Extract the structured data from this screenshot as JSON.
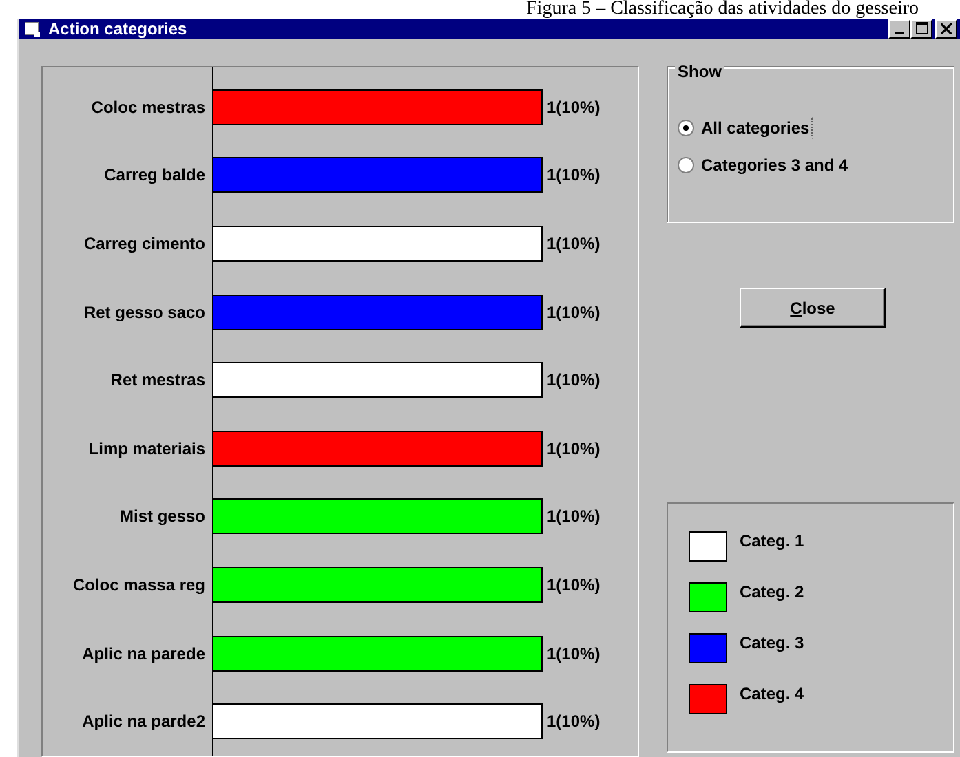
{
  "caption": "Figura 5 – Classificação das atividades do gesseiro",
  "window": {
    "title": "Action categories"
  },
  "rows": [
    {
      "label": "Coloc mestras",
      "color": "#ff0000",
      "reading": "1(10%)"
    },
    {
      "label": "Carreg balde",
      "color": "#0000ff",
      "reading": "1(10%)"
    },
    {
      "label": "Carreg cimento",
      "color": "#ffffff",
      "reading": "1(10%)"
    },
    {
      "label": "Ret gesso saco",
      "color": "#0000ff",
      "reading": "1(10%)"
    },
    {
      "label": "Ret mestras",
      "color": "#ffffff",
      "reading": "1(10%)"
    },
    {
      "label": "Limp materiais",
      "color": "#ff0000",
      "reading": "1(10%)"
    },
    {
      "label": "Mist gesso",
      "color": "#00ff00",
      "reading": "1(10%)"
    },
    {
      "label": "Coloc massa reg",
      "color": "#00ff00",
      "reading": "1(10%)"
    },
    {
      "label": "Aplic na parede",
      "color": "#00ff00",
      "reading": "1(10%)"
    },
    {
      "label": "Aplic na parde2",
      "color": "#ffffff",
      "reading": "1(10%)"
    }
  ],
  "show": {
    "title": "Show",
    "options": [
      {
        "label": "All categories",
        "selected": true
      },
      {
        "label": "Categories 3 and 4",
        "selected": false
      }
    ]
  },
  "close_button": "Close",
  "legend": [
    {
      "label": "Categ. 1",
      "color": "#ffffff"
    },
    {
      "label": "Categ. 2",
      "color": "#00ff00"
    },
    {
      "label": "Categ. 3",
      "color": "#0000ff"
    },
    {
      "label": "Categ. 4",
      "color": "#ff0000"
    }
  ]
}
